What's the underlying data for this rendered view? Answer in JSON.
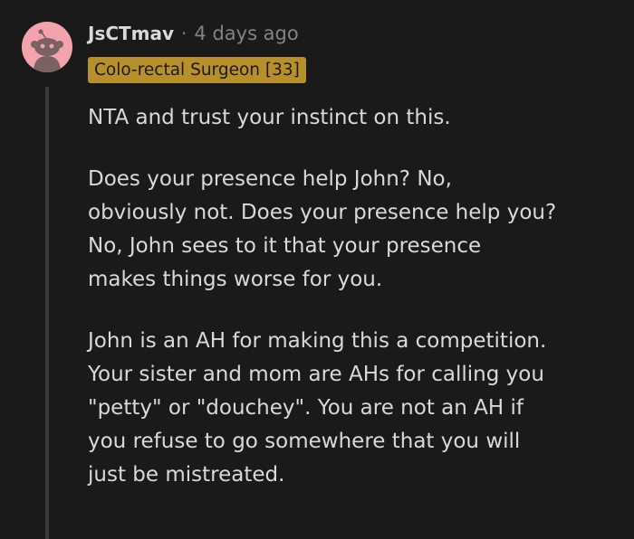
{
  "comment": {
    "author": "JsCTmav",
    "separator": "·",
    "timestamp": "4 days ago",
    "flair": "Colo-rectal Surgeon [33]",
    "paragraphs": [
      [
        "NTA and trust your instinct on this."
      ],
      [
        "Does your presence help John? No,",
        "obviously not. Does your presence help you?",
        "No, John sees to it that your presence",
        "makes things worse for you."
      ],
      [
        "John is an AH for making this a competition.",
        "Your sister and mom are AHs for calling you",
        "\"petty\" or \"douchey\". You are not an AH if",
        "you refuse to go somewhere that you will",
        "just be mistreated."
      ]
    ]
  },
  "colors": {
    "background": "#1a1a1b",
    "text": "#d7dadc",
    "meta": "#818384",
    "flair_bg": "#b8902a",
    "avatar_bg": "#f4a3ad"
  },
  "icons": {
    "avatar": "reddit-snoo-avatar-icon"
  }
}
